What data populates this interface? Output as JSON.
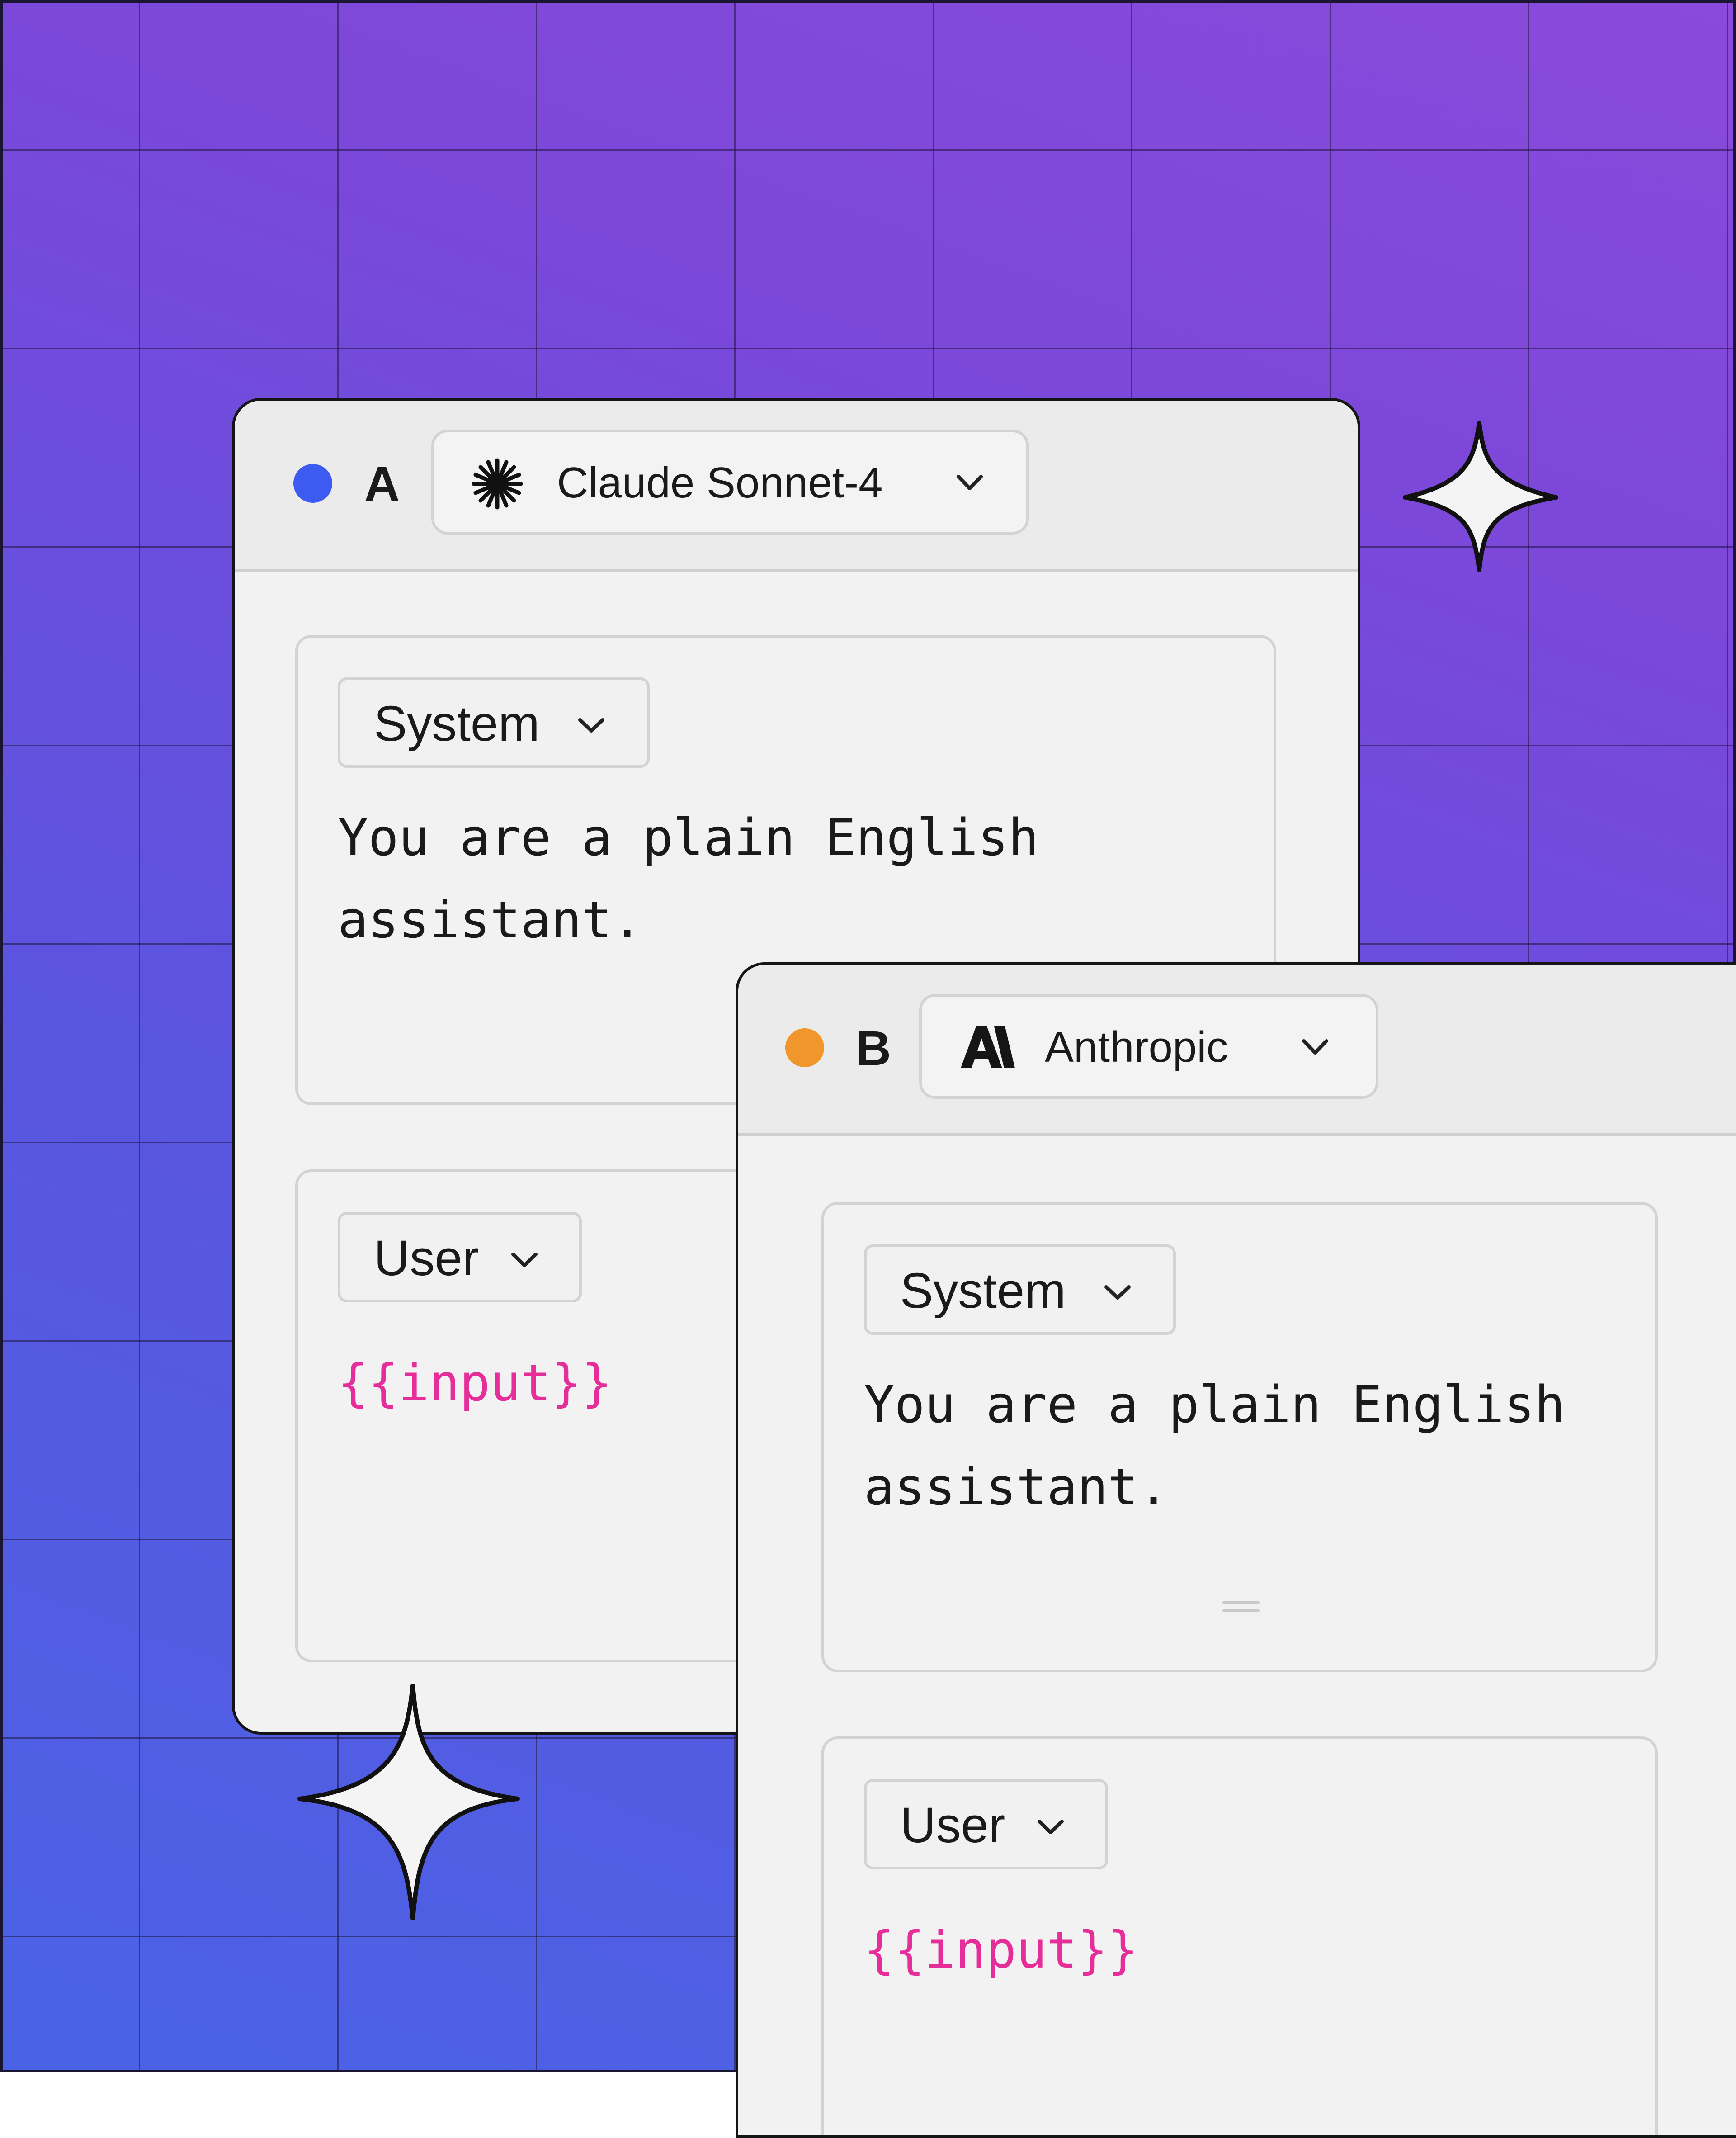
{
  "panels": {
    "a": {
      "letter": "A",
      "dot_color": "#3d5af1",
      "model": {
        "icon": "asterisk-icon",
        "label": "Claude Sonnet-4"
      },
      "system": {
        "role": "System",
        "text_line1": "You are a plain English",
        "text_line2": "assistant."
      },
      "user": {
        "role": "User",
        "text": "{{input}}"
      }
    },
    "b": {
      "letter": "B",
      "dot_color": "#f0962a",
      "model": {
        "icon": "anthropic-logo-icon",
        "label": "Anthropic"
      },
      "system": {
        "role": "System",
        "text_line1": "You are a plain English",
        "text_line2": "assistant."
      },
      "user": {
        "role": "User",
        "text": "{{input}}"
      }
    }
  },
  "colors": {
    "variable": "#e52e9a",
    "panel_bg": "#f2f2f2",
    "border": "#d3d3d3"
  }
}
